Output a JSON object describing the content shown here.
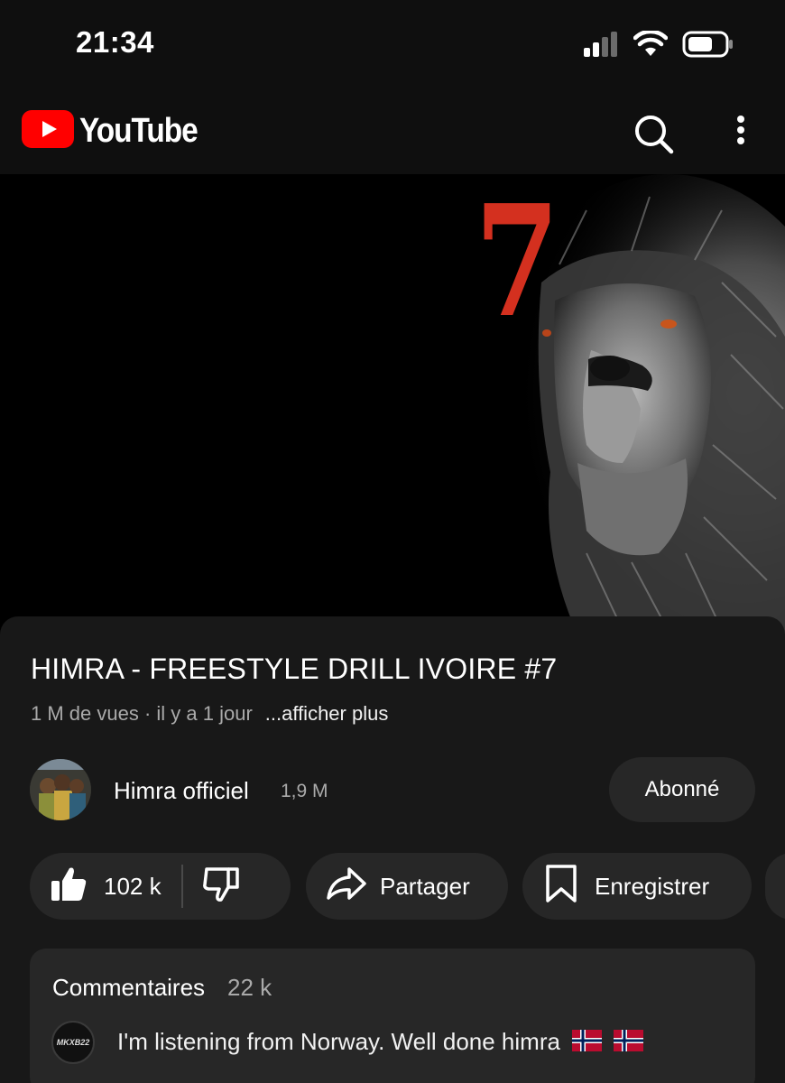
{
  "status_bar": {
    "time": "21:34",
    "icons": [
      "signal-icon",
      "wifi-icon",
      "battery-icon"
    ]
  },
  "header": {
    "app_name": "YouTube",
    "icons": [
      "youtube-logo-icon",
      "search-icon",
      "more-vertical-icon"
    ],
    "brand_color": "#ff0000"
  },
  "video": {
    "thumbnail_text": "7",
    "title": "HIMRA - FREESTYLE DRILL IVOIRE #7",
    "meta": "1 M de vues · il y a 1 jour",
    "more_label": "...afficher plus"
  },
  "channel": {
    "name": "Himra officiel",
    "subscribers": "1,9 M",
    "subscribe_label": "Abonné"
  },
  "actions": {
    "like_count": "102 k",
    "share_label": "Partager",
    "save_label": "Enregistrer"
  },
  "comments": {
    "title": "Commentaires",
    "count": "22 k",
    "first_comment": {
      "avatar_text": "MKXB22",
      "text": "I'm listening from Norway. Well done himra"
    }
  },
  "colors": {
    "background": "#0f0f0f",
    "panel": "#181818",
    "pill": "#272727",
    "seven_red": "#d4301f"
  }
}
